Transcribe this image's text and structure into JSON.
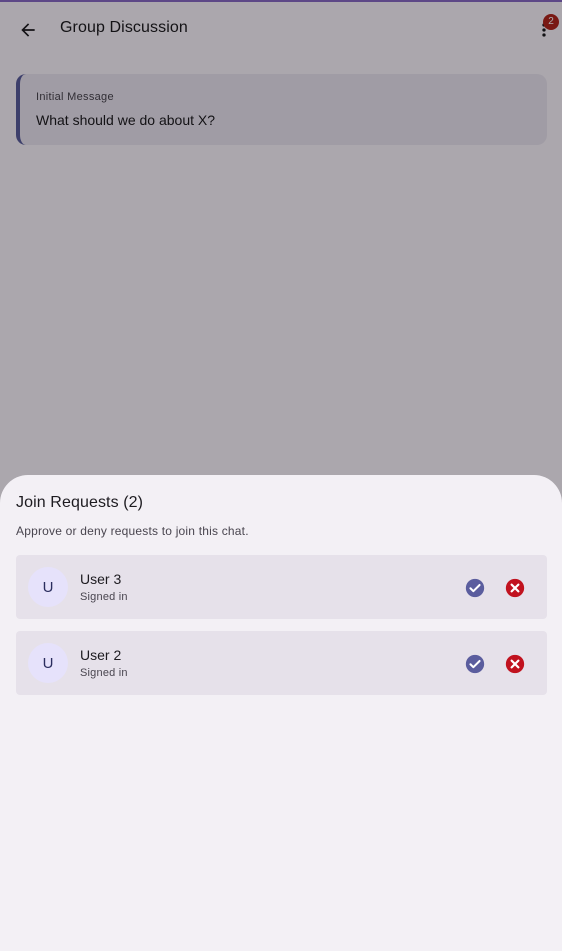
{
  "app_bar": {
    "title": "Group Discussion",
    "notification_count": "2",
    "back_icon": "arrow-back-icon",
    "more_icon": "more-vert-icon"
  },
  "initial_message": {
    "label": "Initial Message",
    "text": "What should we do about X?"
  },
  "sheet": {
    "title": "Join Requests (2)",
    "subtitle": "Approve or deny requests to join this chat.",
    "requests": [
      {
        "avatar": "U",
        "name": "User 3",
        "status": "Signed in"
      },
      {
        "avatar": "U",
        "name": "User 2",
        "status": "Signed in"
      }
    ]
  },
  "colors": {
    "approve": "#5b5d9e",
    "deny": "#c1121f",
    "badge": "#b3261e"
  }
}
